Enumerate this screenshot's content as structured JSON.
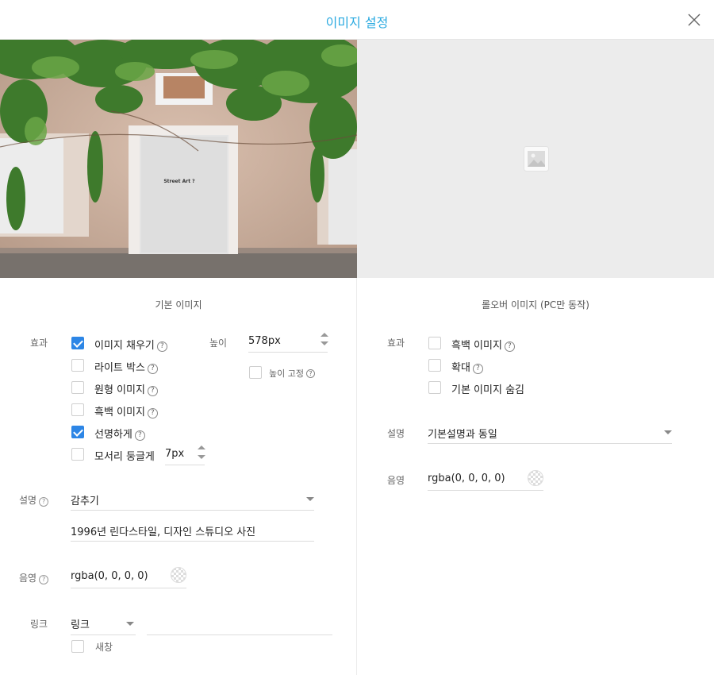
{
  "header": {
    "title": "이미지 설정"
  },
  "photo": {
    "sign_text": "Street Art ?"
  },
  "base": {
    "section_title": "기본 이미지",
    "effect_label": "효과",
    "effects": [
      {
        "label": "이미지 채우기",
        "checked": true,
        "help": true
      },
      {
        "label": "라이트 박스",
        "checked": false,
        "help": true
      },
      {
        "label": "원형 이미지",
        "checked": false,
        "help": true
      },
      {
        "label": "흑백 이미지",
        "checked": false,
        "help": true
      },
      {
        "label": "선명하게",
        "checked": true,
        "help": true
      },
      {
        "label": "모서리 둥글게",
        "checked": false,
        "help": false
      }
    ],
    "corner_radius_value": "7px",
    "height_label": "높이",
    "height_value": "578px",
    "fix_height_label": "높이 고정",
    "caption_label": "설명",
    "caption_select": "감추기",
    "caption_text": "1996년 린다스타일, 디자인 스튜디오 사진",
    "shadow_label": "음영",
    "shadow_value": "rgba(0, 0, 0, 0)",
    "link_label": "링크",
    "link_select": "링크",
    "link_url": "",
    "new_window_label": "새창",
    "new_window_checked": false
  },
  "rollover": {
    "section_title": "롤오버 이미지 (PC만 동작)",
    "effect_label": "효과",
    "effects": [
      {
        "label": "흑백 이미지",
        "checked": false,
        "help": true
      },
      {
        "label": "확대",
        "checked": false,
        "help": true
      },
      {
        "label": "기본 이미지 숨김",
        "checked": false,
        "help": false
      }
    ],
    "caption_label": "설명",
    "caption_select": "기본설명과 동일",
    "shadow_label": "음영",
    "shadow_value": "rgba(0, 0, 0, 0)"
  },
  "colors": {
    "accent": "#29a9e0",
    "checkbox_on": "#2d86e6"
  },
  "icons": {
    "close": "close-icon",
    "help": "help-icon",
    "placeholder": "image-placeholder-icon"
  }
}
